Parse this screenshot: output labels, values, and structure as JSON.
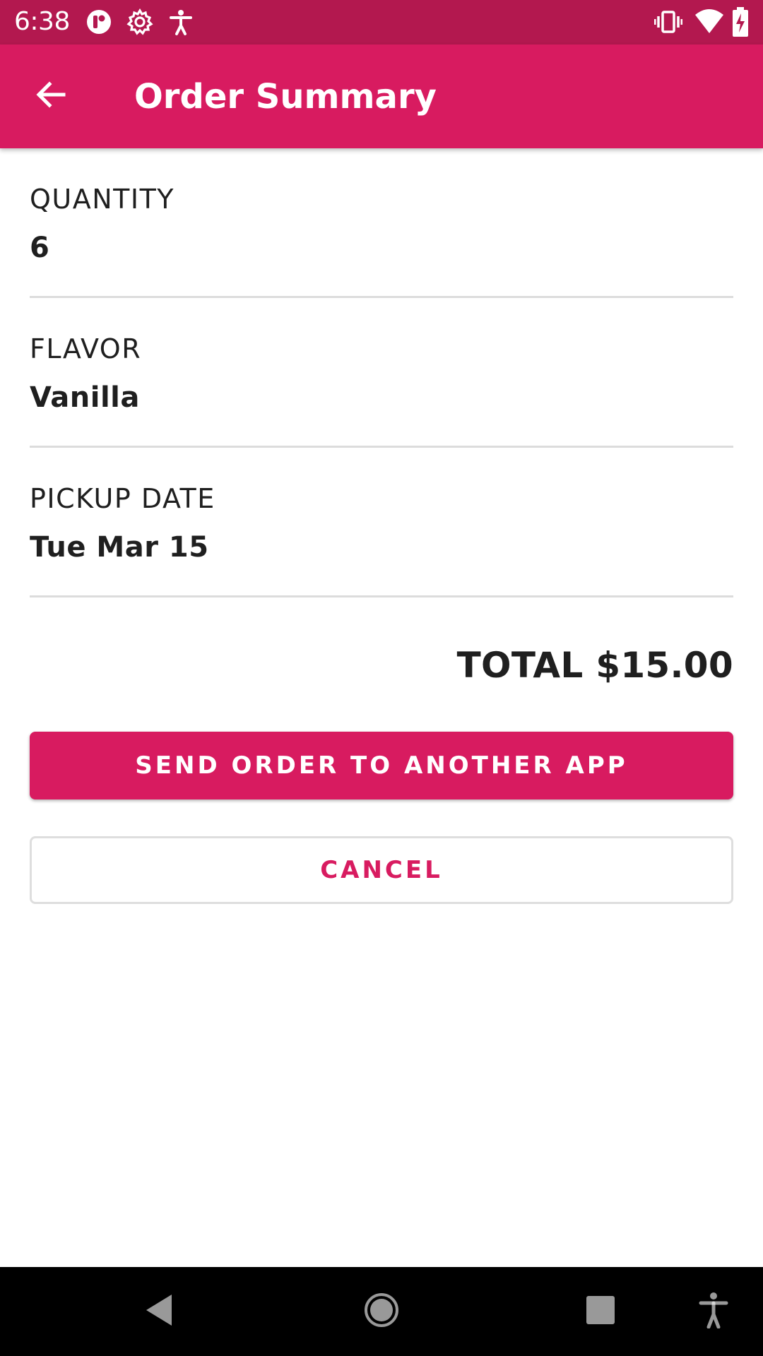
{
  "status_bar": {
    "time": "6:38",
    "left_icons": [
      "app-logo-icon",
      "settings-gear-icon",
      "accessibility-icon"
    ],
    "right_icons": [
      "vibrate-icon",
      "wifi-icon",
      "battery-charging-icon"
    ]
  },
  "app_bar": {
    "title": "Order Summary",
    "back_icon": "arrow-back-icon",
    "color": "#d81b60"
  },
  "summary": {
    "quantity": {
      "label": "QUANTITY",
      "value": "6"
    },
    "flavor": {
      "label": "FLAVOR",
      "value": "Vanilla"
    },
    "pickup_date": {
      "label": "PICKUP DATE",
      "value": "Tue Mar 15"
    }
  },
  "total": "TOTAL $15.00",
  "buttons": {
    "send_label": "SEND ORDER TO ANOTHER APP",
    "cancel_label": "CANCEL"
  },
  "nav_bar": {
    "icons": [
      "back-triangle-icon",
      "home-circle-icon",
      "recents-square-icon",
      "accessibility-icon"
    ]
  },
  "colors": {
    "primary": "#d81b60",
    "status_bar": "#b3184f",
    "text": "#1f1f1f",
    "divider": "#dcdcdc"
  }
}
